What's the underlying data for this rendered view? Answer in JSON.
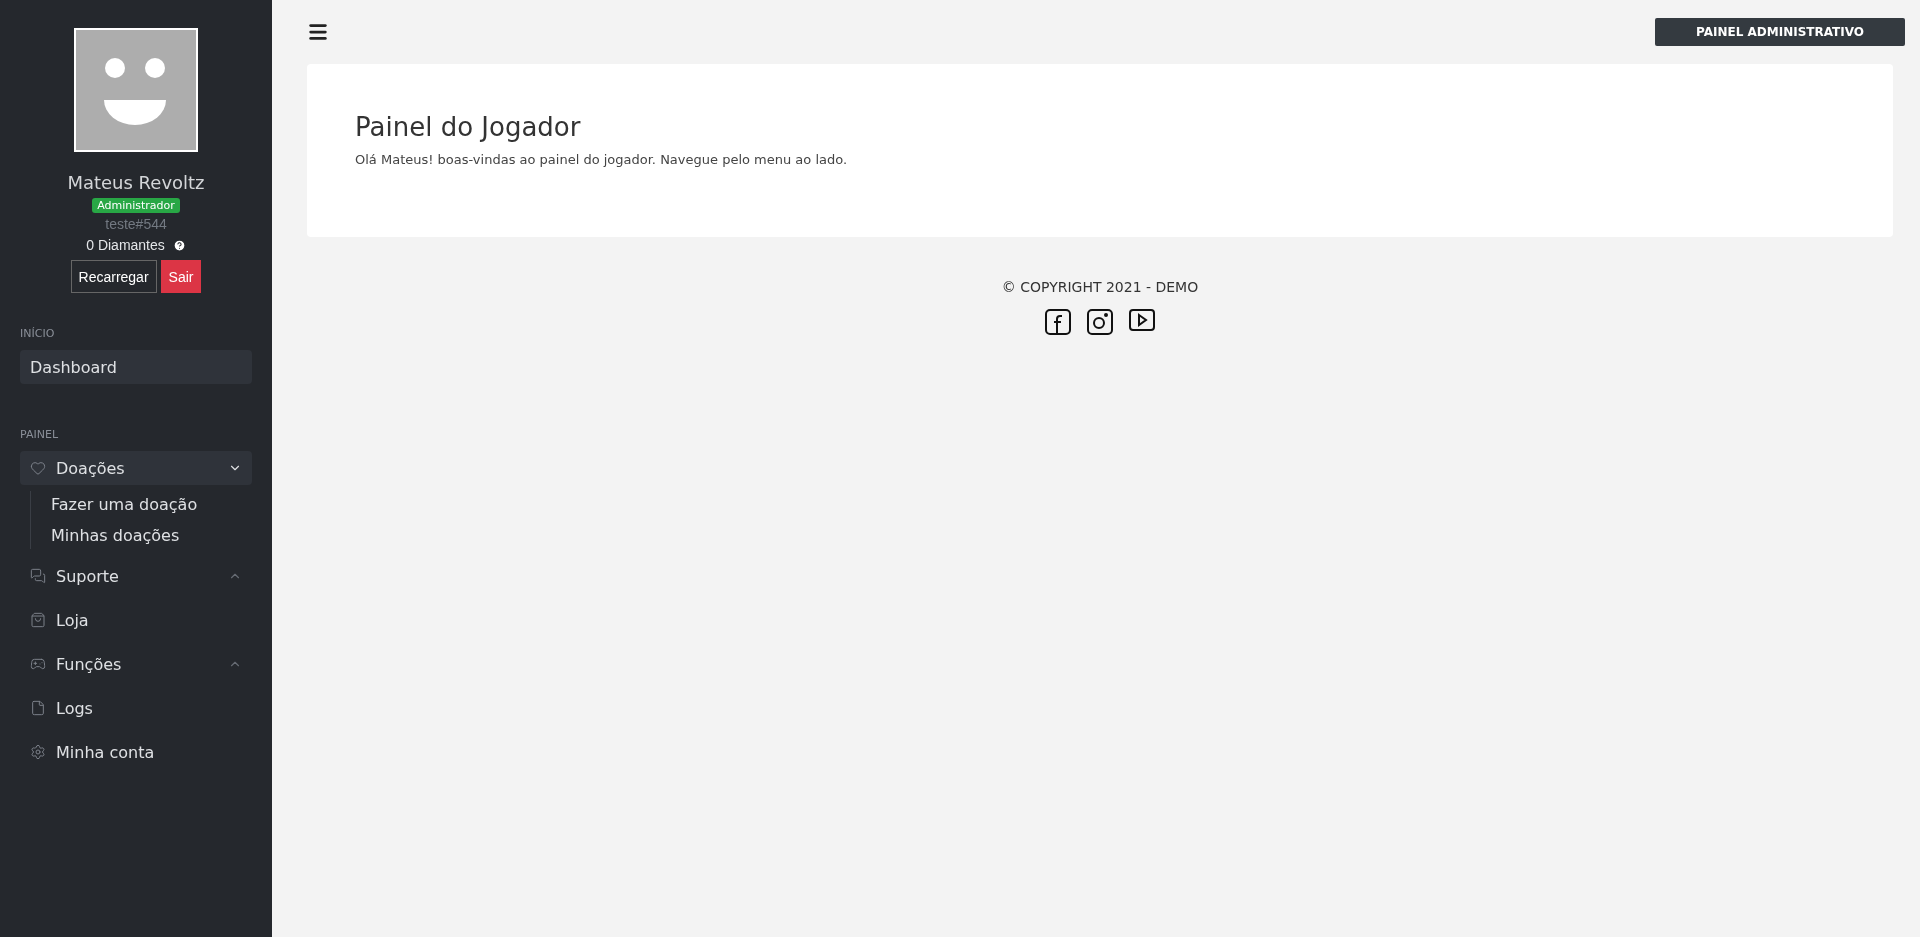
{
  "user": {
    "name": "Mateus Revoltz",
    "role": "Administrador",
    "tag": "teste#544",
    "diamonds": "0 Diamantes",
    "buttons": [
      {
        "label": "Recarregar",
        "kind": "outline"
      },
      {
        "label": "Sair",
        "kind": "danger"
      }
    ]
  },
  "sidebar": {
    "sections": [
      {
        "title": "INÍCIO",
        "items": [
          {
            "label": "Dashboard",
            "kind": "plain",
            "selected": true
          }
        ]
      },
      {
        "title": "PAINEL",
        "items": [
          {
            "label": "Doações",
            "kind": "group",
            "selected": true,
            "expanded": true,
            "children": [
              {
                "label": "Fazer uma doação"
              },
              {
                "label": "Minhas doações"
              }
            ]
          },
          {
            "label": "Suporte",
            "kind": "group",
            "selected": false,
            "expanded": false
          },
          {
            "label": "Loja",
            "kind": "link",
            "selected": false
          },
          {
            "label": "Funções",
            "kind": "group",
            "selected": false,
            "expanded": false
          },
          {
            "label": "Logs",
            "kind": "link",
            "selected": false
          },
          {
            "label": "Minha conta",
            "kind": "link",
            "selected": false
          }
        ]
      }
    ]
  },
  "topbar": {
    "admin_button": "PAINEL ADMINISTRATIVO"
  },
  "card": {
    "title": "Painel do Jogador",
    "text": "Olá Mateus! boas-vindas ao painel do jogador. Navegue pelo menu ao lado."
  },
  "footer": {
    "copyright": "© COPYRIGHT 2021 - DEMO"
  }
}
